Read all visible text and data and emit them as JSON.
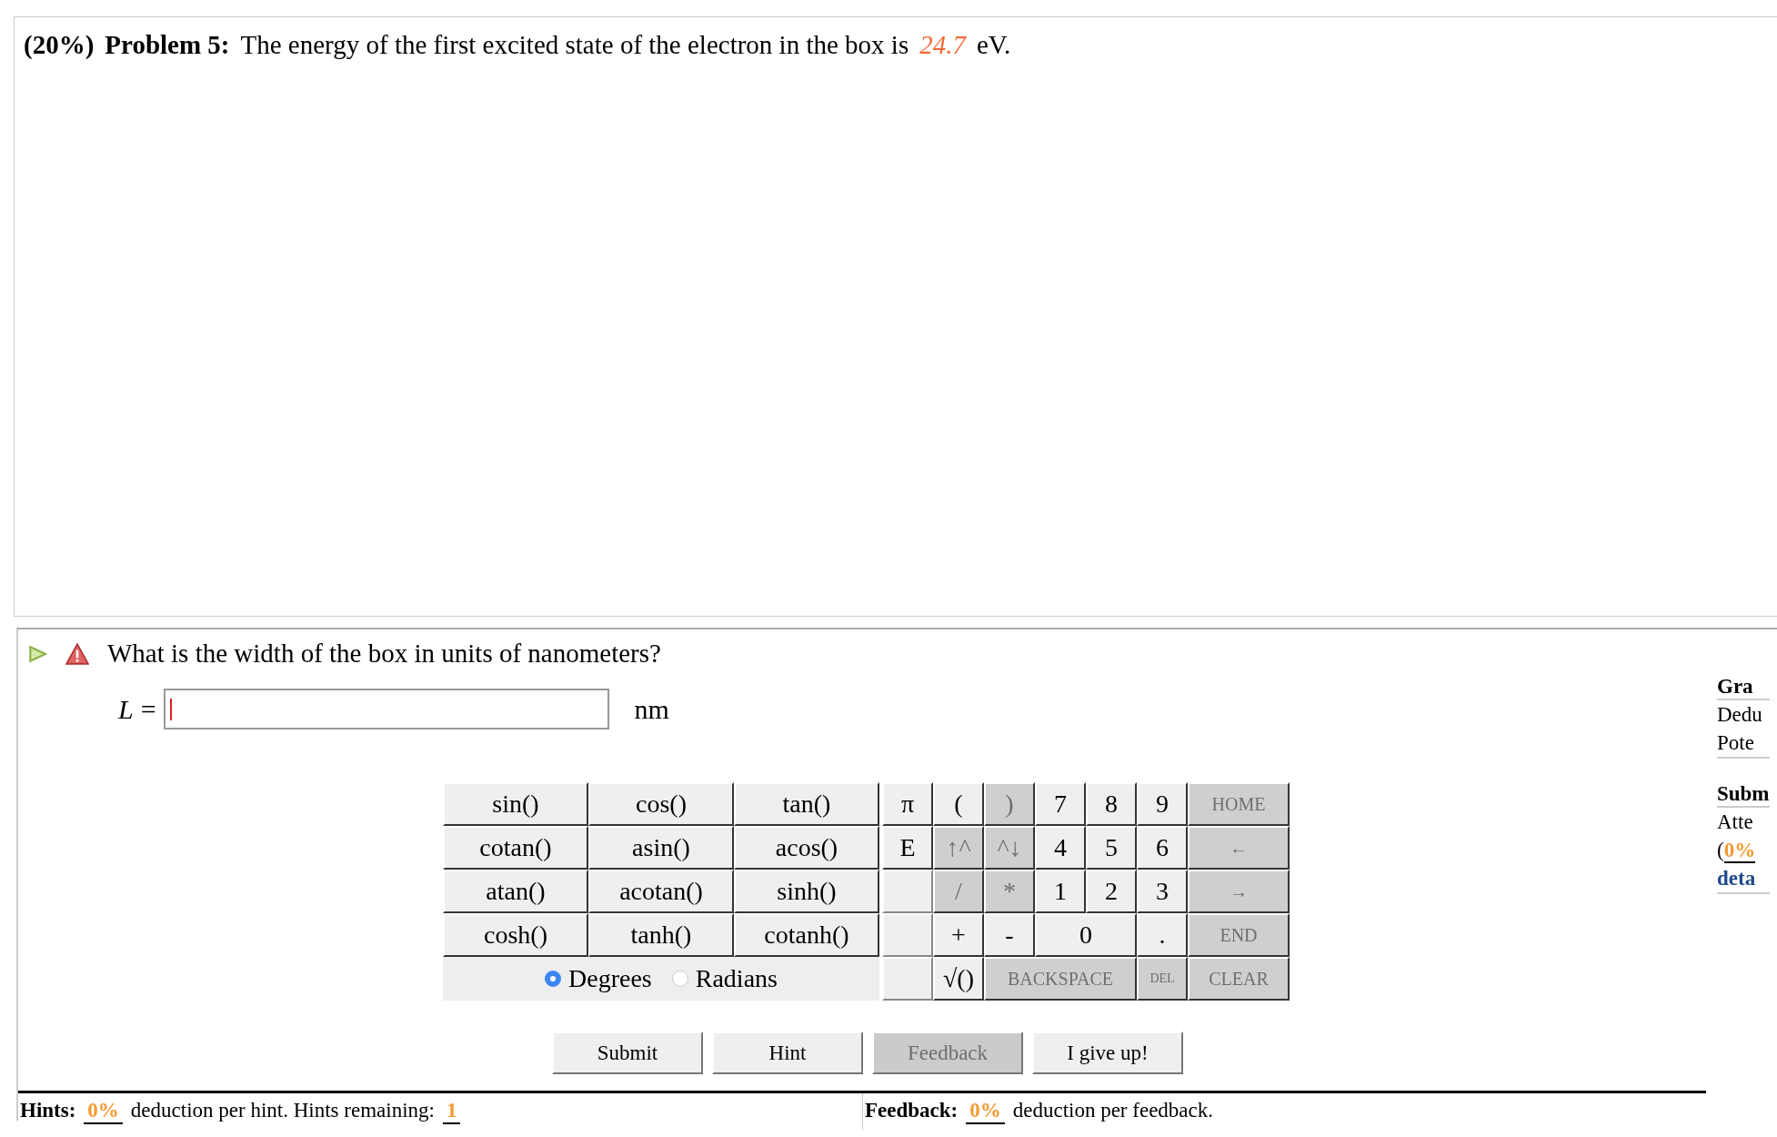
{
  "problem": {
    "weight": "(20%)",
    "label": "Problem 5:",
    "text": "The energy of the first excited state of the electron in the box is",
    "value": "24.7",
    "unit": "eV."
  },
  "question": {
    "text": "What is the width of the box in units of nanometers?",
    "variable": "L",
    "equals": "=",
    "unit": "nm"
  },
  "functions": [
    {
      "label": "sin()"
    },
    {
      "label": "cos()"
    },
    {
      "label": "tan()"
    },
    {
      "label": "cotan()"
    },
    {
      "label": "asin()"
    },
    {
      "label": "acos()"
    },
    {
      "label": "atan()"
    },
    {
      "label": "acotan()"
    },
    {
      "label": "sinh()"
    },
    {
      "label": "cosh()"
    },
    {
      "label": "tanh()"
    },
    {
      "label": "cotanh()"
    }
  ],
  "angle_modes": [
    {
      "label": "Degrees",
      "selected": true
    },
    {
      "label": "Radians",
      "selected": false
    }
  ],
  "keys": [
    {
      "kind": "key",
      "label": "π",
      "disabled": false
    },
    {
      "kind": "key",
      "label": "(",
      "disabled": false
    },
    {
      "kind": "key",
      "label": ")",
      "disabled": true
    },
    {
      "kind": "key",
      "label": "7",
      "disabled": false
    },
    {
      "kind": "key",
      "label": "8",
      "disabled": false
    },
    {
      "kind": "key",
      "label": "9",
      "disabled": false
    },
    {
      "kind": "wide-right",
      "label": "HOME",
      "disabled": true
    },
    {
      "kind": "key",
      "label": "E",
      "disabled": false
    },
    {
      "kind": "key",
      "label": "↑^",
      "disabled": true
    },
    {
      "kind": "key",
      "label": "^↓",
      "disabled": true
    },
    {
      "kind": "key",
      "label": "4",
      "disabled": false
    },
    {
      "kind": "key",
      "label": "5",
      "disabled": false
    },
    {
      "kind": "key",
      "label": "6",
      "disabled": false
    },
    {
      "kind": "wide-right",
      "label": "←",
      "disabled": true
    },
    {
      "kind": "blank"
    },
    {
      "kind": "key",
      "label": "/",
      "disabled": true
    },
    {
      "kind": "key",
      "label": "*",
      "disabled": true
    },
    {
      "kind": "key",
      "label": "1",
      "disabled": false
    },
    {
      "kind": "key",
      "label": "2",
      "disabled": false
    },
    {
      "kind": "key",
      "label": "3",
      "disabled": false
    },
    {
      "kind": "wide-right",
      "label": "→",
      "disabled": true
    },
    {
      "kind": "blank"
    },
    {
      "kind": "key",
      "label": "+",
      "disabled": false
    },
    {
      "kind": "key",
      "label": "-",
      "disabled": false
    },
    {
      "kind": "double",
      "label": "0",
      "disabled": false
    },
    {
      "kind": "key",
      "label": ".",
      "disabled": false
    },
    {
      "kind": "wide-right",
      "label": "END",
      "disabled": true
    },
    {
      "kind": "blank"
    },
    {
      "kind": "key",
      "label": "√()",
      "disabled": false
    },
    {
      "kind": "triple",
      "label": "BACKSPACE",
      "disabled": true
    },
    {
      "kind": "small",
      "label": "DEL",
      "disabled": true
    },
    {
      "kind": "wide-right",
      "label": "CLEAR",
      "disabled": true
    }
  ],
  "actions": [
    {
      "label": "Submit",
      "disabled": false
    },
    {
      "label": "Hint",
      "disabled": false
    },
    {
      "label": "Feedback",
      "disabled": true
    },
    {
      "label": "I give up!",
      "disabled": false
    }
  ],
  "hints": {
    "label": "Hints:",
    "deduction": "0%",
    "text": "deduction per hint. Hints remaining:",
    "remaining": "1"
  },
  "feedback": {
    "label": "Feedback:",
    "deduction": "0%",
    "text": "deduction per feedback."
  },
  "side_panel": [
    {
      "heading": "Gra",
      "lines": [
        {
          "kind": "text",
          "text": "Dedu"
        },
        {
          "kind": "text",
          "text": "Pote"
        }
      ]
    },
    {
      "heading": "Subm",
      "lines": [
        {
          "kind": "text",
          "text": "Atte"
        },
        {
          "kind": "penalty",
          "prefix": "(",
          "text": "0%"
        },
        {
          "kind": "link",
          "text": "deta"
        }
      ]
    }
  ]
}
